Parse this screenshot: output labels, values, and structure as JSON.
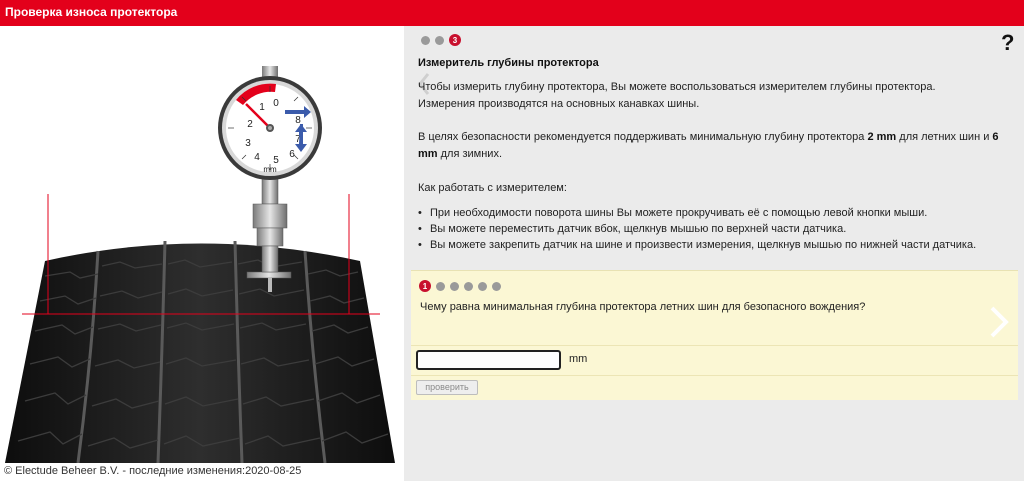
{
  "header": {
    "title": "Проверка износа протектора"
  },
  "pager": {
    "current": "3"
  },
  "help_label": "?",
  "content": {
    "title": "Измеритель глубины протектора",
    "p1_line1": "Чтобы измерить глубину протектора, Вы можете воспользоваться измерителем глубины протектора.",
    "p1_line2": "Измерения производятся на основных канавках шины.",
    "p2_a": "В целях безопасности рекомендуется поддерживать минимальную глубину протектора ",
    "p2_b": "2 mm",
    "p2_c": " для летних шин и ",
    "p2_d": "6",
    "p2_e": "mm",
    "p2_f": " для зимних.",
    "p3": "Как работать с измерителем:",
    "bullets": [
      "При необходимости поворота шины Вы можете прокручивать её с помощью левой кнопки мыши.",
      "Вы можете переместить датчик вбок, щелкнув мышью по верхней части датчика.",
      "Вы можете закрепить датчик на шине и произвести измерения, щелкнув мышью по нижней части датчика."
    ]
  },
  "quiz": {
    "step": "1",
    "question": "Чему равна минимальная глубина протектора летних шин для безопасного вождения?",
    "answer_value": "",
    "unit": "mm",
    "check_label": "проверить"
  },
  "gauge": {
    "numbers": [
      "0",
      "1",
      "2",
      "3",
      "4",
      "5",
      "6",
      "7",
      "8"
    ],
    "unit": "mm"
  },
  "footer": {
    "text": "© Electude Beheer B.V. - последние изменения:2020-08-25"
  },
  "colors": {
    "brand_red": "#e3001b",
    "quiz_bg": "#fbf7d4",
    "panel_bg": "#ebebeb"
  }
}
